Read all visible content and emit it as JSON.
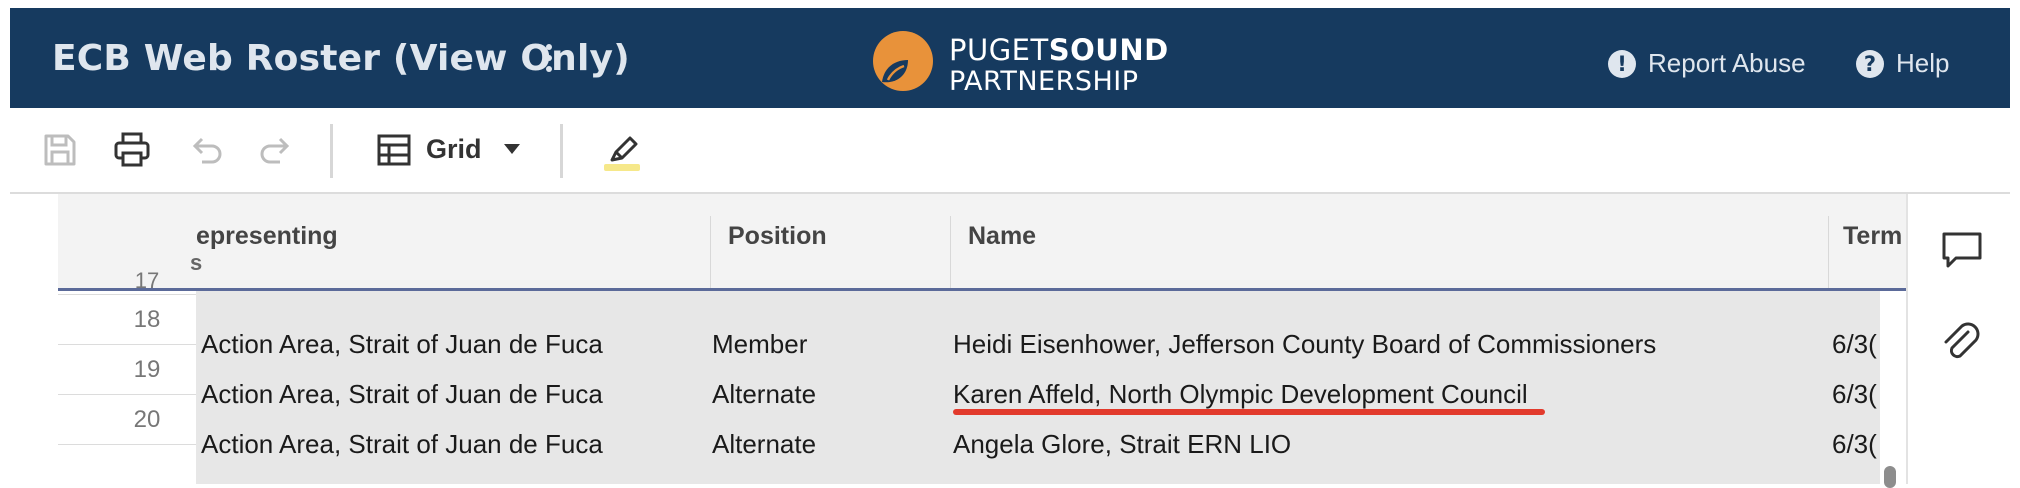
{
  "header": {
    "app_title": "ECB Web Roster (View Only)",
    "logo": {
      "line1_light": "PUGET",
      "line1_bold": "SOUND",
      "line2": "PARTNERSHIP"
    },
    "report_abuse": "Report Abuse",
    "help": "Help",
    "colors": {
      "bar": "#163a5f",
      "logo_orange": "#e8923a"
    }
  },
  "toolbar": {
    "view_label": "Grid",
    "icons": [
      "save-icon",
      "print-icon",
      "undo-icon",
      "redo-icon",
      "grid-icon",
      "chevron-down-icon",
      "highlighter-icon"
    ]
  },
  "table": {
    "columns": [
      {
        "label": "epresenting",
        "sub": "s"
      },
      {
        "label": "Position"
      },
      {
        "label": "Name"
      },
      {
        "label": "Term"
      }
    ],
    "partial_row_number": "17",
    "rows": [
      {
        "num": "18",
        "representing": "Action Area, Strait of Juan de Fuca",
        "position": "Member",
        "name": "Heidi Eisenhower, Jefferson County Board of Commissioners",
        "term": "6/3("
      },
      {
        "num": "19",
        "representing": "Action Area, Strait of Juan de Fuca",
        "position": "Alternate",
        "name": "Karen Affeld, North Olympic Development Council",
        "term": "6/3("
      },
      {
        "num": "20",
        "representing": "Action Area, Strait of Juan de Fuca",
        "position": "Alternate",
        "name": "Angela Glore, Strait ERN LIO",
        "term": "6/3("
      }
    ]
  },
  "rail": {
    "icons": [
      "comment-icon",
      "attachment-icon"
    ]
  }
}
